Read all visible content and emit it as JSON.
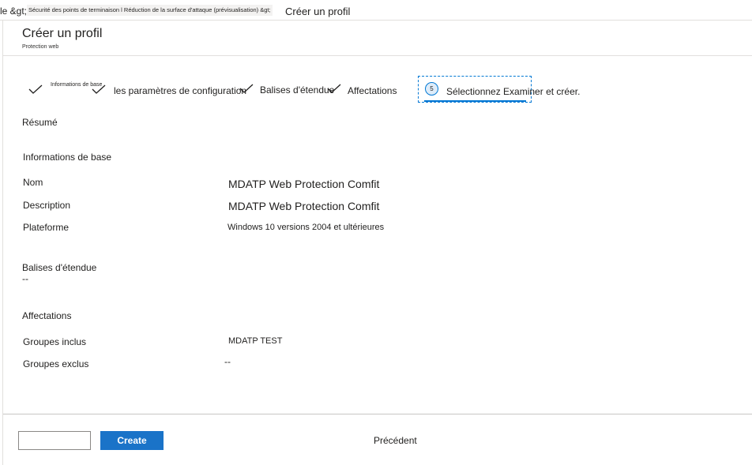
{
  "breadcrumb": {
    "prefix": "le &gt;",
    "middle": "Sécurité des points de terminaison l Réduction de la surface d'attaque (prévisualisation) &gt;",
    "current": "Créer un profil"
  },
  "header": {
    "title": "Créer un profil",
    "subtitle": "Protection web"
  },
  "steps": [
    {
      "label": "Informations de base",
      "status": "completed"
    },
    {
      "label": "les paramètres de configuration",
      "status": "completed"
    },
    {
      "label": "Balises d'étendue",
      "status": "completed"
    },
    {
      "label": "Affectations",
      "status": "completed"
    },
    {
      "number": "5",
      "label": "Sélectionnez Examiner et créer.",
      "status": "current"
    }
  ],
  "summary": {
    "heading": "Résumé",
    "basics": {
      "heading": "Informations de base",
      "rows": [
        {
          "label": "Nom",
          "value": "MDATP Web Protection Comfit"
        },
        {
          "label": "Description",
          "value": "MDATP Web Protection Comfit"
        },
        {
          "label": "Plateforme",
          "value": "Windows 10 versions 2004 et ultérieures"
        }
      ]
    },
    "scope": {
      "heading": "Balises d'étendue",
      "value": "--"
    },
    "assignments": {
      "heading": "Affectations",
      "rows": [
        {
          "label": "Groupes inclus",
          "value": "MDATP TEST"
        },
        {
          "label": "Groupes exclus",
          "value": "--"
        }
      ]
    }
  },
  "footer": {
    "create_label": "Create",
    "previous_label": "Précédent"
  },
  "colors": {
    "accent": "#0078d4",
    "create_button": "#1a73c8"
  }
}
